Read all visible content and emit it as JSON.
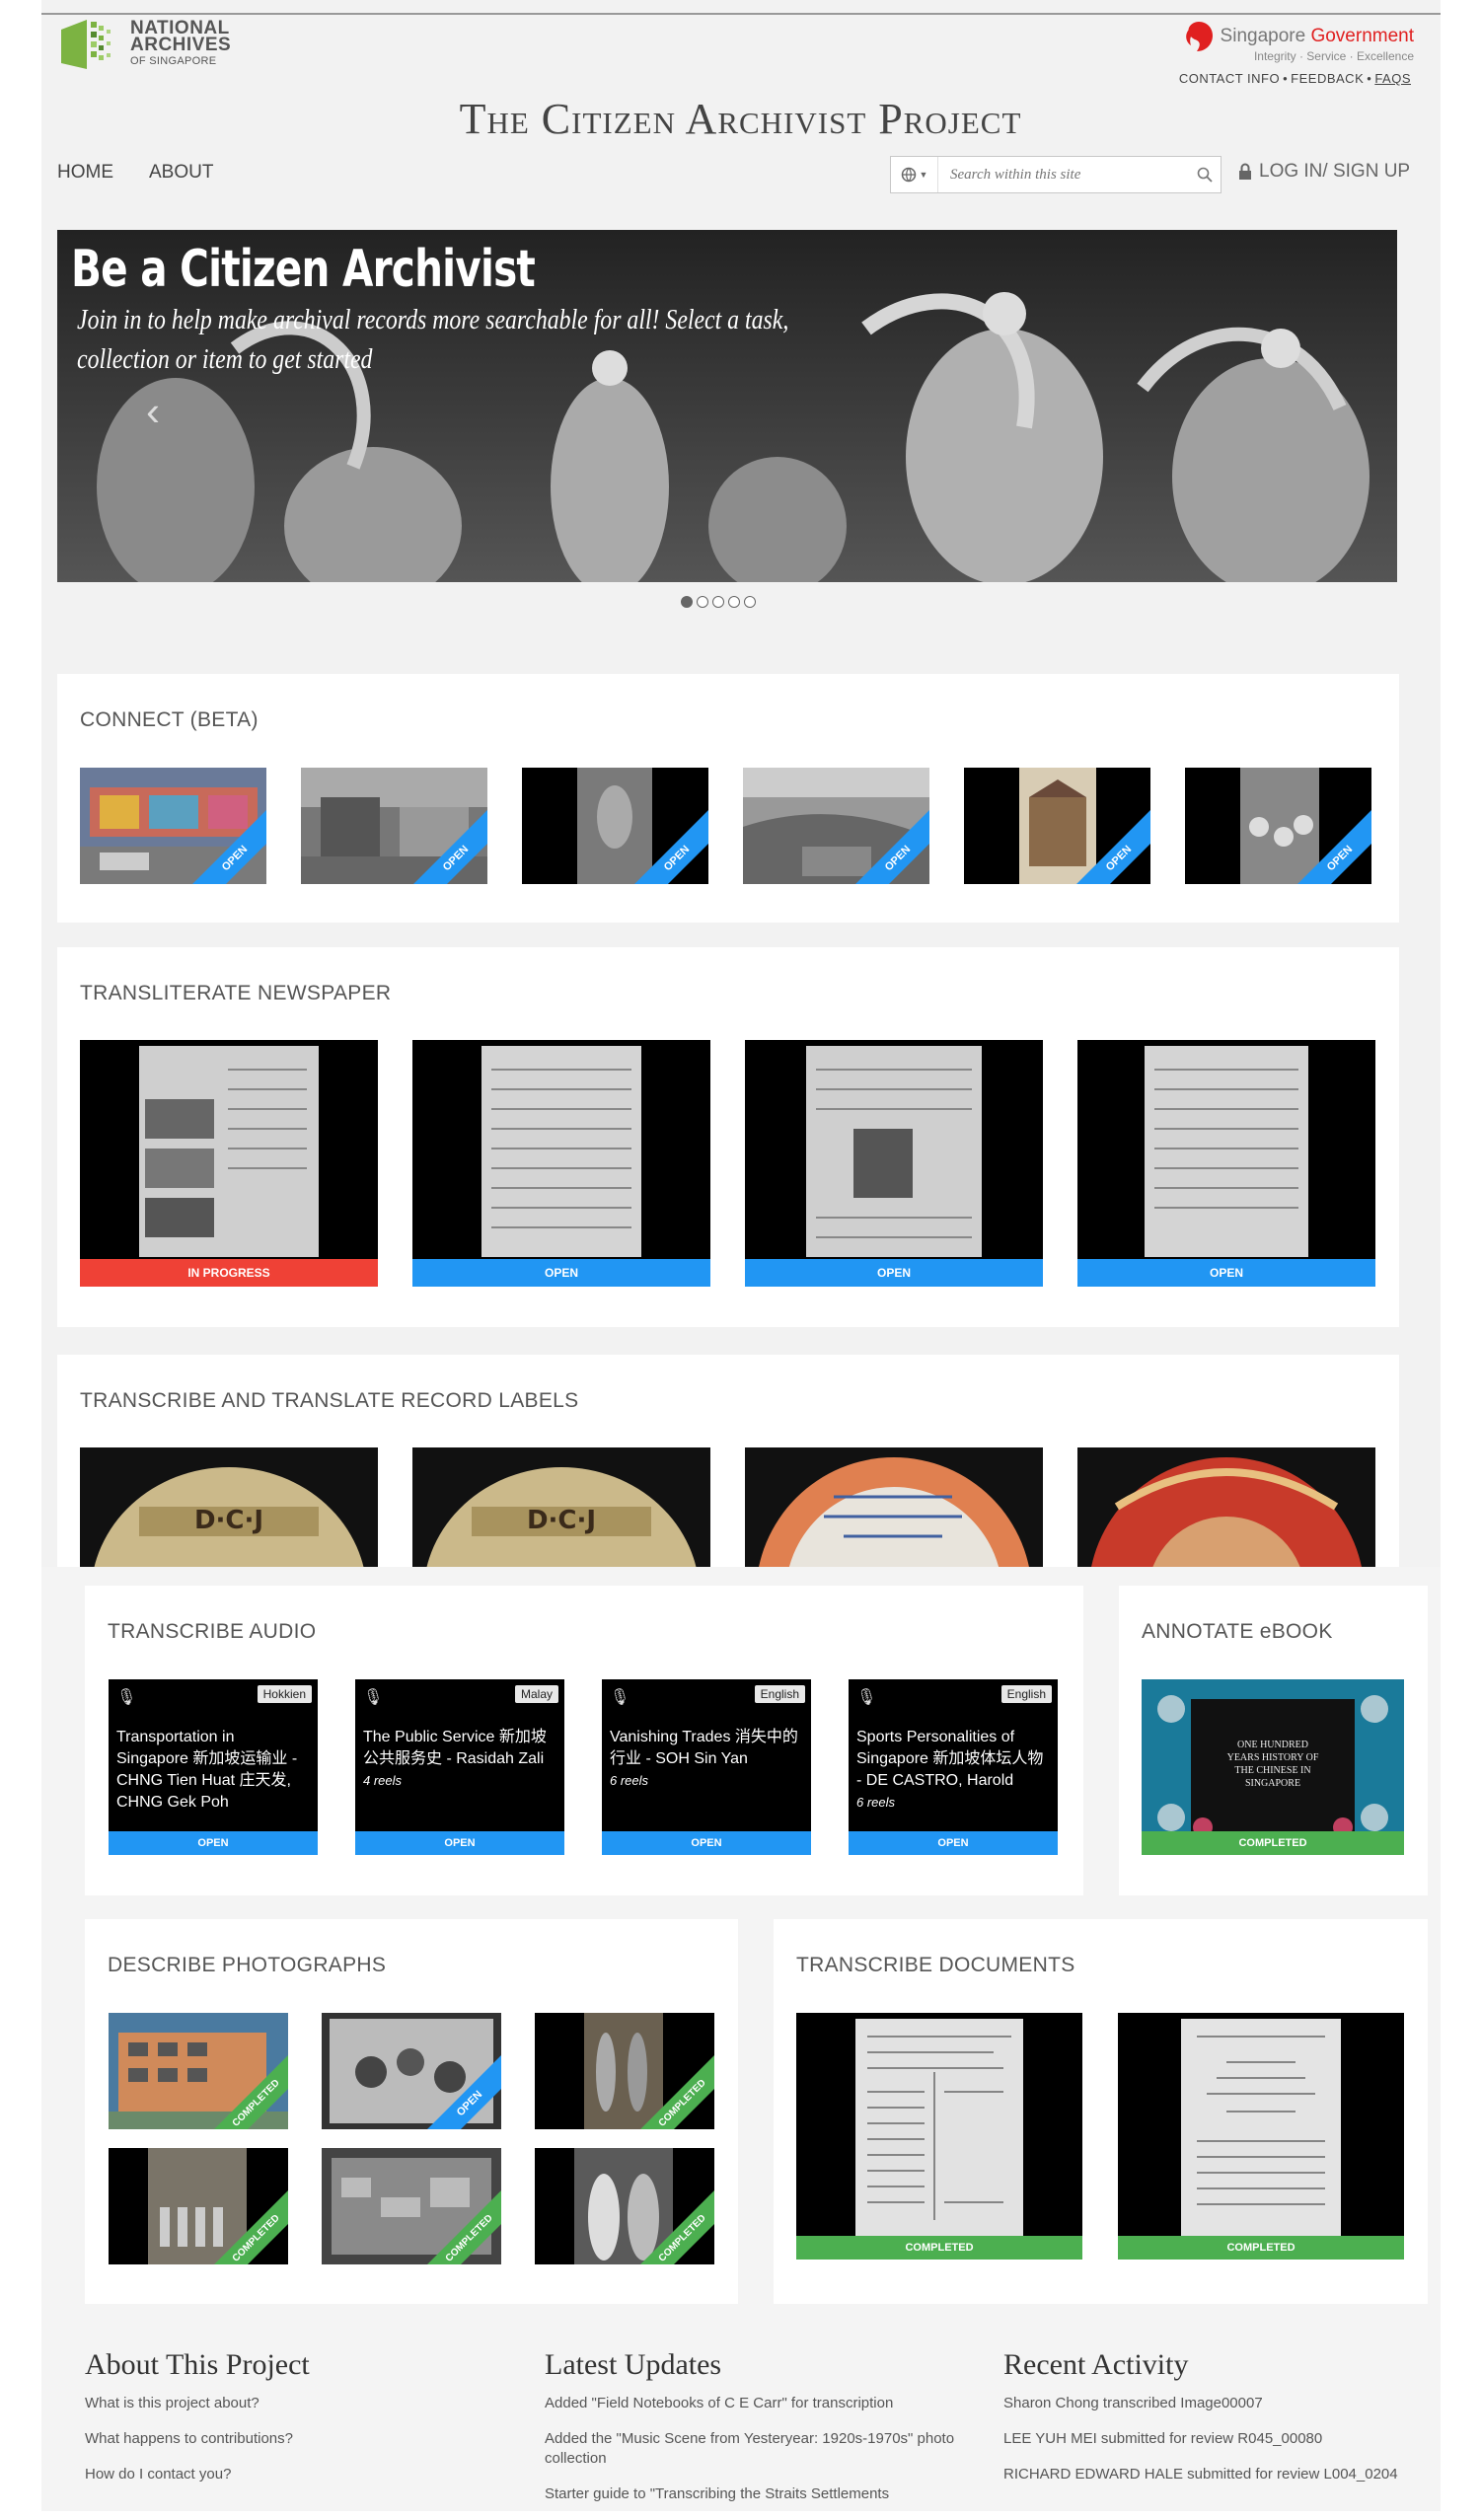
{
  "header": {
    "logo_line1": "NATIONAL",
    "logo_line2": "ARCHIVES",
    "logo_line3": "OF SINGAPORE",
    "gov_name_a": "Singapore ",
    "gov_name_b": "Government",
    "gov_tagline": "Integrity · Service · Excellence",
    "gov_links": [
      "CONTACT INFO",
      "FEEDBACK",
      "FAQS"
    ],
    "site_title": "The Citizen Archivist Project",
    "nav": [
      "HOME",
      "ABOUT"
    ],
    "search_placeholder": "Search within this site",
    "login": "LOG IN/ SIGN UP"
  },
  "hero": {
    "title": "Be a Citizen Archivist",
    "subtitle": "Join in to help make archival records more searchable for all! Select a task, collection or item to get started",
    "slide_count": 5,
    "active_slide": 1
  },
  "sections": {
    "connect": {
      "title": "CONNECT (BETA)",
      "ribbons": [
        "OPEN",
        "OPEN",
        "OPEN",
        "OPEN",
        "OPEN",
        "OPEN"
      ]
    },
    "newspaper": {
      "title": "TRANSLITERATE NEWSPAPER",
      "status": [
        "IN PROGRESS",
        "OPEN",
        "OPEN",
        "OPEN"
      ]
    },
    "records": {
      "title": "TRANSCRIBE AND TRANSLATE RECORD LABELS"
    },
    "audio": {
      "title": "TRANSCRIBE AUDIO",
      "items": [
        {
          "lang": "Hokkien",
          "title": "Transportation in Singapore 新加坡运输业 - CHNG Tien Huat 庄天发, CHNG Gek Poh",
          "reels": "",
          "status": "OPEN"
        },
        {
          "lang": "Malay",
          "title": "The Public Service 新加坡公共服务史 - Rasidah Zali",
          "reels": "4 reels",
          "status": "OPEN"
        },
        {
          "lang": "English",
          "title": "Vanishing Trades 消失中的行业 - SOH Sin Yan",
          "reels": "6 reels",
          "status": "OPEN"
        },
        {
          "lang": "English",
          "title": "Sports Personalities of Singapore 新加坡体坛人物 - DE CASTRO, Harold",
          "reels": "6 reels",
          "status": "OPEN"
        }
      ]
    },
    "ebook": {
      "title": "ANNOTATE eBOOK",
      "book_text": "ONE HUNDRED YEARS HISTORY OF THE CHINESE IN SINGAPORE",
      "status": "COMPLETED"
    },
    "photos": {
      "title": "DESCRIBE PHOTOGRAPHS",
      "ribbons": [
        "COMPLETED",
        "OPEN",
        "COMPLETED",
        "COMPLETED",
        "COMPLETED",
        "COMPLETED"
      ]
    },
    "documents": {
      "title": "TRANSCRIBE DOCUMENTS",
      "status": [
        "COMPLETED",
        "COMPLETED"
      ]
    }
  },
  "footer": {
    "about": {
      "title": "About This Project",
      "links": [
        "What is this project about?",
        "What happens to contributions?",
        "How do I contact you?"
      ]
    },
    "updates": {
      "title": "Latest Updates",
      "links": [
        "Added \"Field Notebooks of C E Carr\" for transcription",
        "Added the \"Music Scene from Yesteryear: 1920s-1970s\" photo collection",
        "Starter guide to \"Transcribing the Straits Settlements"
      ]
    },
    "activity": {
      "title": "Recent Activity",
      "links": [
        "Sharon Chong transcribed Image00007",
        "LEE YUH MEI submitted for review R045_00080",
        "RICHARD EDWARD HALE submitted for review L004_0204"
      ]
    }
  }
}
